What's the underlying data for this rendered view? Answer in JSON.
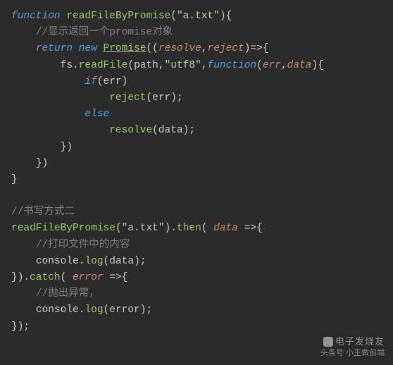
{
  "code": {
    "l1_kw_function": "function",
    "l1_fn": "readFileByPromise",
    "l1_p_open": "(",
    "l1_str": "\"a.txt\"",
    "l1_p_close_brace": "){",
    "l2_comment": "//显示返回一个promise对象",
    "l3_kw_return": "return",
    "l3_kw_new": "new",
    "l3_class": "Promise",
    "l3_p_open": "((",
    "l3_param1": "resolve",
    "l3_comma": ",",
    "l3_param2": "reject",
    "l3_arrow_brace": ")=>{",
    "l4_obj": "fs",
    "l4_dot": ".",
    "l4_method": "readFile",
    "l4_p_open": "(",
    "l4_arg1": "path",
    "l4_comma1": ",",
    "l4_str": "\"utf8\"",
    "l4_comma2": ",",
    "l4_kw_function": "function",
    "l4_p_open2": "(",
    "l4_param1": "err",
    "l4_comma3": ",",
    "l4_param2": "data",
    "l4_close": "){",
    "l5_kw_if": "if",
    "l5_open": "(",
    "l5_var": "err",
    "l5_close": ")",
    "l6_fn": "reject",
    "l6_open": "(",
    "l6_arg": "err",
    "l6_close": ");",
    "l7_kw_else": "else",
    "l8_fn": "resolve",
    "l8_open": "(",
    "l8_arg": "data",
    "l8_close": ");",
    "l9_close": "})",
    "l10_close": "})",
    "l11_close": "}",
    "l13_comment": "//书写方式二",
    "l14_fn": "readFileByPromise",
    "l14_open": "(",
    "l14_str": "\"a.txt\"",
    "l14_close_dot": ").",
    "l14_then": "then",
    "l14_open2": "( ",
    "l14_param": "data",
    "l14_arrow": " =>{",
    "l15_comment": "//打印文件中的内容",
    "l16_obj": "console",
    "l16_dot": ".",
    "l16_method": "log",
    "l16_open": "(",
    "l16_arg": "data",
    "l16_close": ");",
    "l17_close_dot": "}).",
    "l17_catch": "catch",
    "l17_open": "( ",
    "l17_param": "error",
    "l17_arrow": " =>{",
    "l18_comment": "//抛出异常，",
    "l19_obj": "console",
    "l19_dot": ".",
    "l19_method": "log",
    "l19_open": "(",
    "l19_arg": "error",
    "l19_close": ");",
    "l20_close": "});"
  },
  "watermark": {
    "line1": "电子发烧友",
    "line2": "头条号  小王做前端"
  }
}
